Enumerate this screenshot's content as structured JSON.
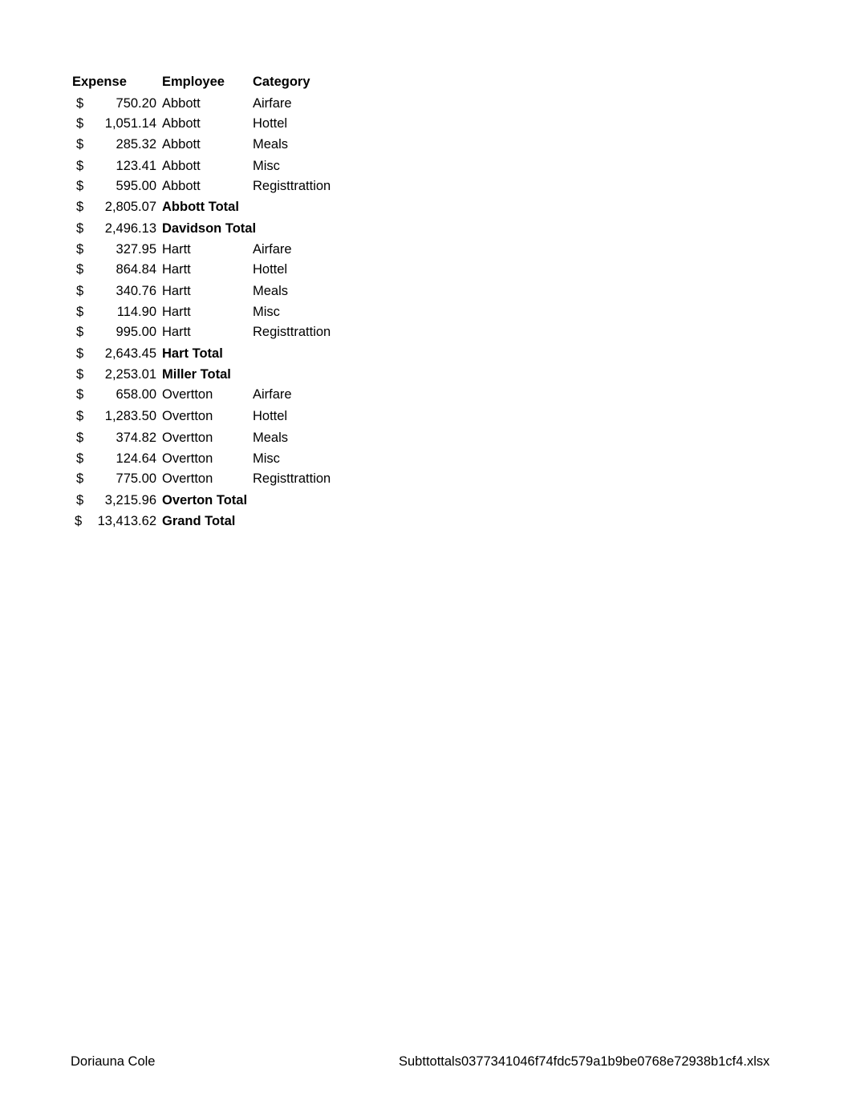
{
  "header": {
    "expense": "Expense",
    "employee": "Employee",
    "category": "Category"
  },
  "currency_symbol": "$",
  "rows": [
    {
      "amount": "750.20",
      "employee": "Abbott",
      "category": "Airfare",
      "is_total": false
    },
    {
      "amount": "1,051.14",
      "employee": "Abbott",
      "category": "Hottel",
      "is_total": false
    },
    {
      "amount": "285.32",
      "employee": "Abbott",
      "category": "Meals",
      "is_total": false
    },
    {
      "amount": "123.41",
      "employee": "Abbott",
      "category": "Misc",
      "is_total": false
    },
    {
      "amount": "595.00",
      "employee": "Abbott",
      "category": "Registtrattion",
      "is_total": false
    },
    {
      "amount": "2,805.07",
      "employee": "Abbott Total",
      "category": "",
      "is_total": true
    },
    {
      "amount": "2,496.13",
      "employee": "Davidson Total",
      "category": "",
      "is_total": true
    },
    {
      "amount": "327.95",
      "employee": "Hartt",
      "category": "Airfare",
      "is_total": false
    },
    {
      "amount": "864.84",
      "employee": "Hartt",
      "category": "Hottel",
      "is_total": false
    },
    {
      "amount": "340.76",
      "employee": "Hartt",
      "category": "Meals",
      "is_total": false
    },
    {
      "amount": "114.90",
      "employee": "Hartt",
      "category": "Misc",
      "is_total": false
    },
    {
      "amount": "995.00",
      "employee": "Hartt",
      "category": "Registtrattion",
      "is_total": false
    },
    {
      "amount": "2,643.45",
      "employee": "Hart Total",
      "category": "",
      "is_total": true
    },
    {
      "amount": "2,253.01",
      "employee": "Miller Total",
      "category": "",
      "is_total": true
    },
    {
      "amount": "658.00",
      "employee": "Overtton",
      "category": "Airfare",
      "is_total": false
    },
    {
      "amount": "1,283.50",
      "employee": "Overtton",
      "category": "Hottel",
      "is_total": false
    },
    {
      "amount": "374.82",
      "employee": "Overtton",
      "category": "Meals",
      "is_total": false
    },
    {
      "amount": "124.64",
      "employee": "Overtton",
      "category": "Misc",
      "is_total": false
    },
    {
      "amount": "775.00",
      "employee": "Overtton",
      "category": "Registtrattion",
      "is_total": false
    },
    {
      "amount": "3,215.96",
      "employee": "Overton Total",
      "category": "",
      "is_total": true
    },
    {
      "amount": "13,413.62",
      "employee": "Grand Total",
      "category": "",
      "is_total": true
    }
  ],
  "footer": {
    "author": "Doriauna Cole",
    "filename": "Subttottals0377341046f74fdc579a1b9be0768e72938b1cf4.xlsx"
  }
}
